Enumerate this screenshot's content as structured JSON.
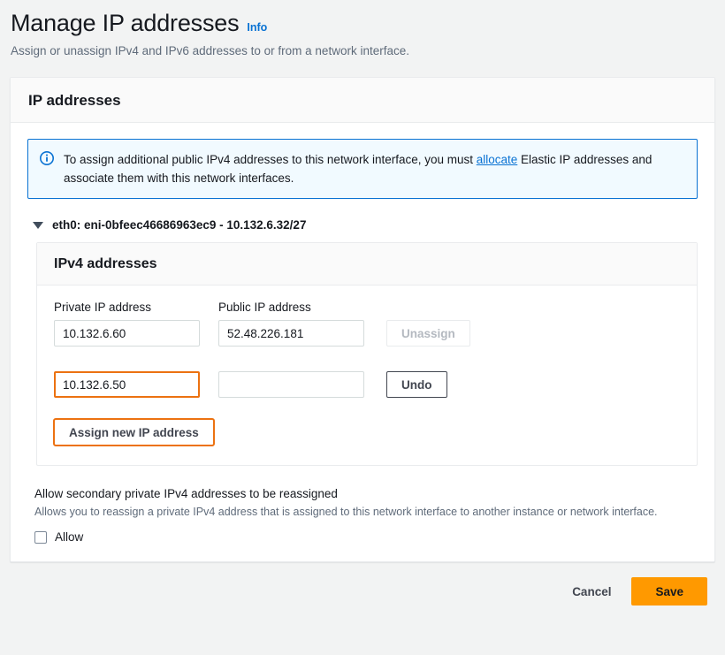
{
  "header": {
    "title": "Manage IP addresses",
    "info_link": "Info",
    "subtitle": "Assign or unassign IPv4 and IPv6 addresses to or from a network interface."
  },
  "card": {
    "title": "IP addresses",
    "alert": {
      "icon": "info-circle-icon",
      "text_before_link": "To assign additional public IPv4 addresses to this network interface, you must ",
      "link_text": "allocate",
      "text_after_link": " Elastic IP addresses and associate them with this network interfaces."
    },
    "eni": {
      "caret": "caret-down-icon",
      "label": "eth0: eni-0bfeec46686963ec9 - 10.132.6.32/27"
    },
    "ipv4_panel": {
      "title": "IPv4 addresses",
      "columns": {
        "private": "Private IP address",
        "public": "Public IP address"
      },
      "rows": [
        {
          "private_ip": "10.132.6.60",
          "public_ip": "52.48.226.181",
          "private_focused": false,
          "action_label": "Unassign",
          "action_state": "disabled"
        },
        {
          "private_ip": "10.132.6.50",
          "public_ip": "",
          "private_focused": true,
          "action_label": "Undo",
          "action_state": "enabled"
        }
      ],
      "assign_button": "Assign new IP address"
    },
    "allow": {
      "title": "Allow secondary private IPv4 addresses to be reassigned",
      "description": "Allows you to reassign a private IPv4 address that is assigned to this network interface to another instance or network interface.",
      "checkbox_label": "Allow",
      "checked": false
    }
  },
  "footer": {
    "cancel": "Cancel",
    "save": "Save"
  },
  "colors": {
    "accent_orange": "#ff9900",
    "focus_orange": "#ec7211",
    "link_blue": "#0972d3",
    "page_bg": "#f2f3f3"
  }
}
